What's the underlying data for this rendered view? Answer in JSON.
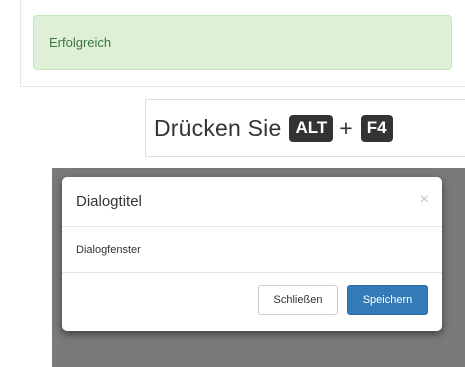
{
  "alert": {
    "text": "Erfolgreich",
    "color": "#dff0d8"
  },
  "keyboard": {
    "prefix": "Drücken Sie",
    "key1": "ALT",
    "plus": "+",
    "key2": "F4"
  },
  "modal": {
    "title": "Dialogtitel",
    "close_glyph": "×",
    "body": "Dialogfenster",
    "close_button": "Schließen",
    "save_button": "Speichern",
    "primary_color": "#337ab7"
  }
}
